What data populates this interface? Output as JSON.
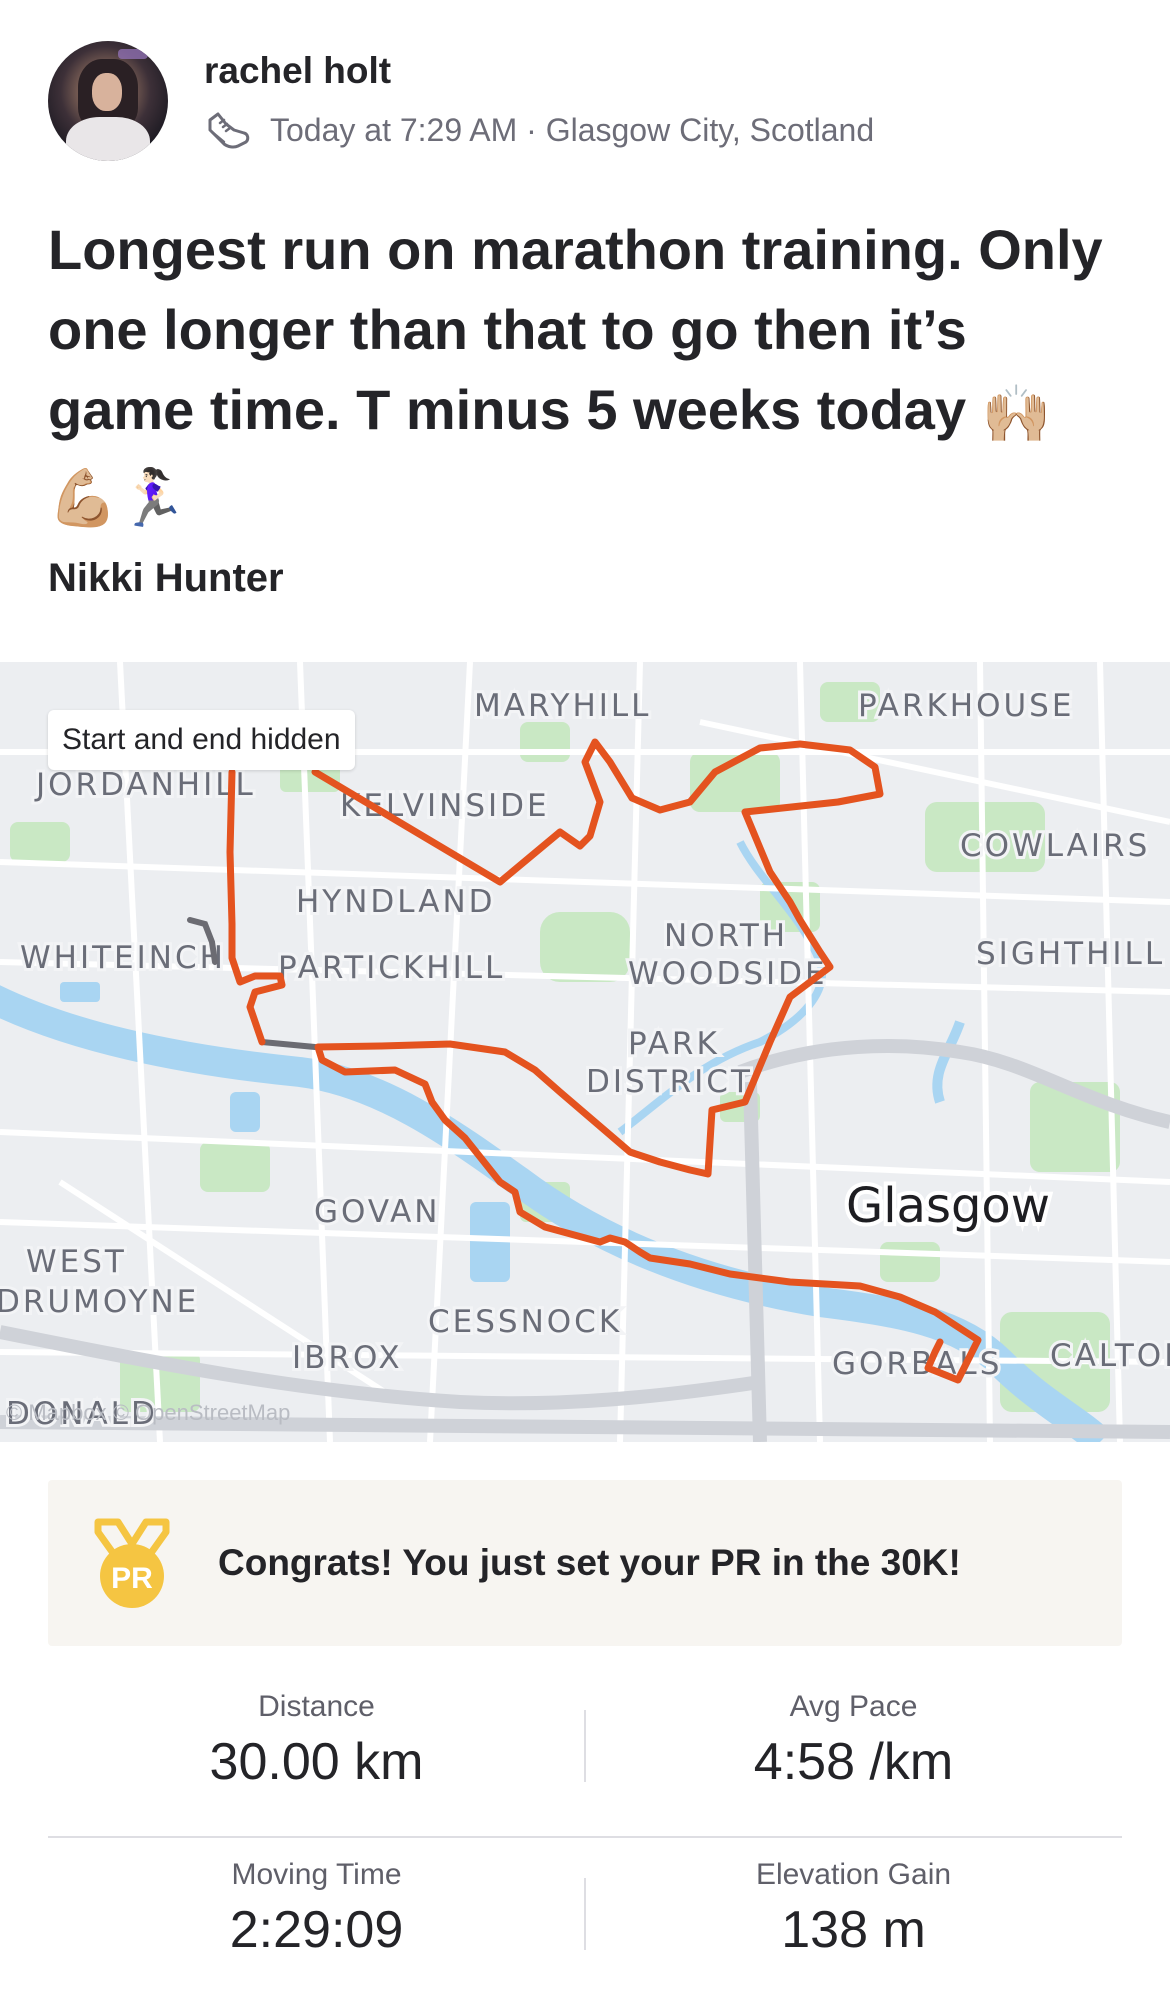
{
  "athlete": {
    "name": "rachel holt",
    "meta": "Today at 7:29 AM · Glasgow City, Scotland",
    "activity_icon": "running-shoe-icon"
  },
  "post": {
    "title": "Longest run on marathon training. Only one longer than that to go then it’s game time. T minus 5 weeks today",
    "emoji": [
      "🙌🏼",
      "💪🏼",
      "🏃🏻‍♀️"
    ],
    "tagged_athlete": "Nikki Hunter"
  },
  "map": {
    "privacy_label": "Start and end hidden",
    "attribution": "© Mapbox © OpenStreetMap",
    "route_color": "#e4531f",
    "hidden_segment_color": "#6b6b72",
    "places": {
      "maryhill": "MARYHILL",
      "parkhouse": "PARKHOUSE",
      "jordanhill": "JORDANHILL",
      "kelvinside": "KELVINSIDE",
      "cowlairs": "COWLAIRS",
      "hyndland": "HYNDLAND",
      "north": "NORTH",
      "woodside": "WOODSIDE",
      "whiteinch": "WHITEINCH",
      "partickhill": "PARTICKHILL",
      "sighthill": "SIGHTHILL",
      "park": "PARK",
      "district": "DISTRICT",
      "govan": "GOVAN",
      "west": "WEST",
      "drumoyne": "DRUMOYNE",
      "cessnock": "CESSNOCK",
      "ibrox": "IBROX",
      "gorbals": "GORBALS",
      "calton": "CALTON",
      "donald": "DONALD",
      "city": "Glasgow"
    }
  },
  "achievement": {
    "icon": "pr-medal-icon",
    "badge_text": "PR",
    "message": "Congrats! You just set your PR in the 30K!"
  },
  "stats": {
    "distance": {
      "label": "Distance",
      "value": "30.00 km"
    },
    "pace": {
      "label": "Avg Pace",
      "value": "4:58 /km"
    },
    "moving_time": {
      "label": "Moving Time",
      "value": "2:29:09"
    },
    "elevation": {
      "label": "Elevation Gain",
      "value": "138 m"
    }
  }
}
